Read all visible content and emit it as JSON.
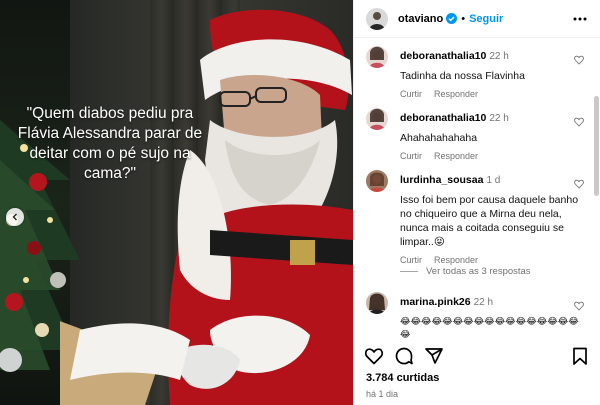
{
  "post": {
    "caption": "\"Quem diabos pediu pra Flávia Alessandra parar de deitar com o pé sujo na cama?\"",
    "likes": "3.784 curtidas",
    "time_ago": "há 1 dia"
  },
  "header": {
    "username": "otaviano",
    "separator": "•",
    "follow_label": "Seguir"
  },
  "comments": [
    {
      "user": "deboranathalia10",
      "time": "22 h",
      "text": "Tadinha da nossa Flavinha",
      "reply": "Curtir",
      "respond": "Responder"
    },
    {
      "user": "deboranathalia10",
      "time": "22 h",
      "text": "Ahahahahahaha",
      "reply": "Curtir",
      "respond": "Responder"
    },
    {
      "user": "lurdinha_sousaa",
      "time": "1 d",
      "text": "Isso foi bem por causa daquele banho no chiqueiro que a Mirna deu nela, nunca mais a coitada conseguiu se limpar..😝",
      "reply": "Curtir",
      "respond": "Responder"
    },
    {
      "user": "marina.pink26",
      "time": "22 h",
      "text": "😂😂😂😂😂😂😂😂😂😂😂😂😂😂😂😂😂😂"
    }
  ],
  "view_replies": "Ver todas as 3 respostas",
  "icons": {
    "like": "heart-icon",
    "comment": "comment-icon",
    "share": "share-icon",
    "save": "bookmark-icon",
    "more": "more-options-icon",
    "verified": "verified-badge-icon",
    "carousel_prev": "chevron-left-icon"
  },
  "colors": {
    "accent": "#0095f6",
    "muted": "#737373",
    "santa_red": "#b3121b"
  }
}
